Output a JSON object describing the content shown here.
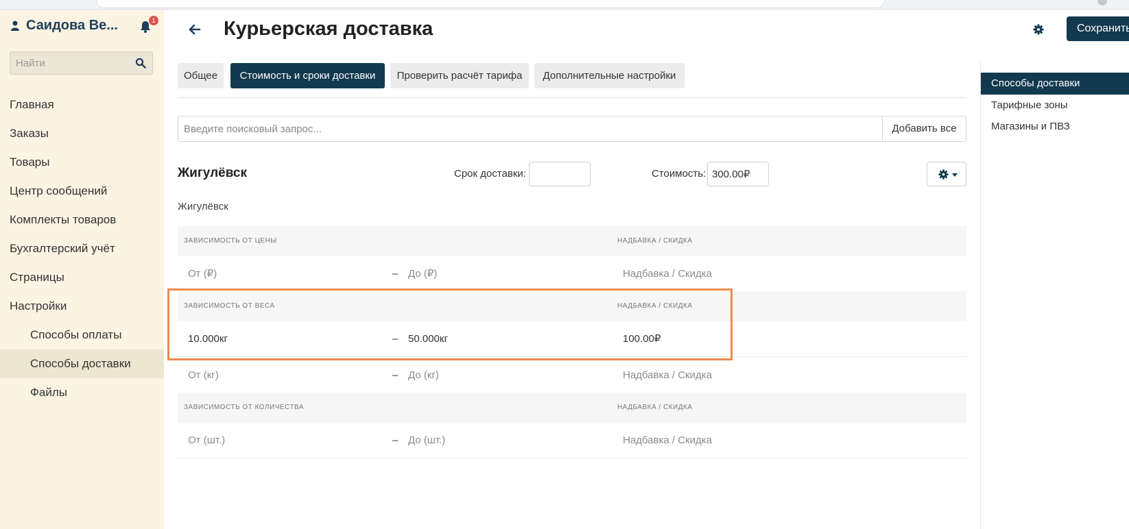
{
  "sidebar": {
    "user_name": "Саидова Ве...",
    "notification_count": "1",
    "search_placeholder": "Найти",
    "items": [
      {
        "label": "Главная"
      },
      {
        "label": "Заказы"
      },
      {
        "label": "Товары"
      },
      {
        "label": "Центр сообщений"
      },
      {
        "label": "Комплекты товаров"
      },
      {
        "label": "Бухгалтерский учёт"
      },
      {
        "label": "Страницы"
      },
      {
        "label": "Настройки"
      },
      {
        "label": "Способы оплаты"
      },
      {
        "label": "Способы доставки",
        "active": true
      },
      {
        "label": "Файлы"
      }
    ]
  },
  "header": {
    "title": "Курьерская доставка",
    "save_label": "Сохранить"
  },
  "tabs": [
    {
      "label": "Общее"
    },
    {
      "label": "Стоимость и сроки доставки",
      "active": true
    },
    {
      "label": "Проверить расчёт тарифа"
    },
    {
      "label": "Дополнительные настройки"
    }
  ],
  "search": {
    "placeholder": "Введите поисковый запрос...",
    "add_all_label": "Добавить все"
  },
  "city": {
    "title": "Жигулёвск",
    "subtitle": "Жигулёвск",
    "delivery_time_label": "Срок доставки:",
    "delivery_time_value": "",
    "cost_label": "Стоимость:",
    "cost_value": "300.00₽"
  },
  "rules": {
    "price": {
      "header_left": "ЗАВИСИМОСТЬ ОТ ЦЕНЫ",
      "header_right": "НАДБАВКА / СКИДКА",
      "rows": [
        {
          "from": "От (₽)",
          "dash": "–",
          "to": "До (₽)",
          "markup": "Надбавка / Скидка"
        }
      ]
    },
    "weight": {
      "header_left": "ЗАВИСИМОСТЬ ОТ ВЕСА",
      "header_right": "НАДБАВКА / СКИДКА",
      "rows": [
        {
          "from": "10.000кг",
          "dash": "–",
          "to": "50.000кг",
          "markup": "100.00₽"
        },
        {
          "from": "От (кг)",
          "dash": "–",
          "to": "До (кг)",
          "markup": "Надбавка / Скидка"
        }
      ]
    },
    "quantity": {
      "header_left": "ЗАВИСИМОСТЬ ОТ КОЛИЧЕСТВА",
      "header_right": "НАДБАВКА / СКИДКА",
      "rows": [
        {
          "from": "От (шт.)",
          "dash": "–",
          "to": "До (шт.)",
          "markup": "Надбавка / Скидка"
        }
      ]
    }
  },
  "right_panel": {
    "items": [
      {
        "label": "Способы доставки",
        "active": true
      },
      {
        "label": "Тарифные зоны"
      },
      {
        "label": "Магазины и ПВЗ"
      }
    ]
  },
  "colors": {
    "primary": "#12394e",
    "sidebar_bg": "#fbf4e3",
    "highlight": "#ee8a4c",
    "badge": "#d9534f"
  }
}
